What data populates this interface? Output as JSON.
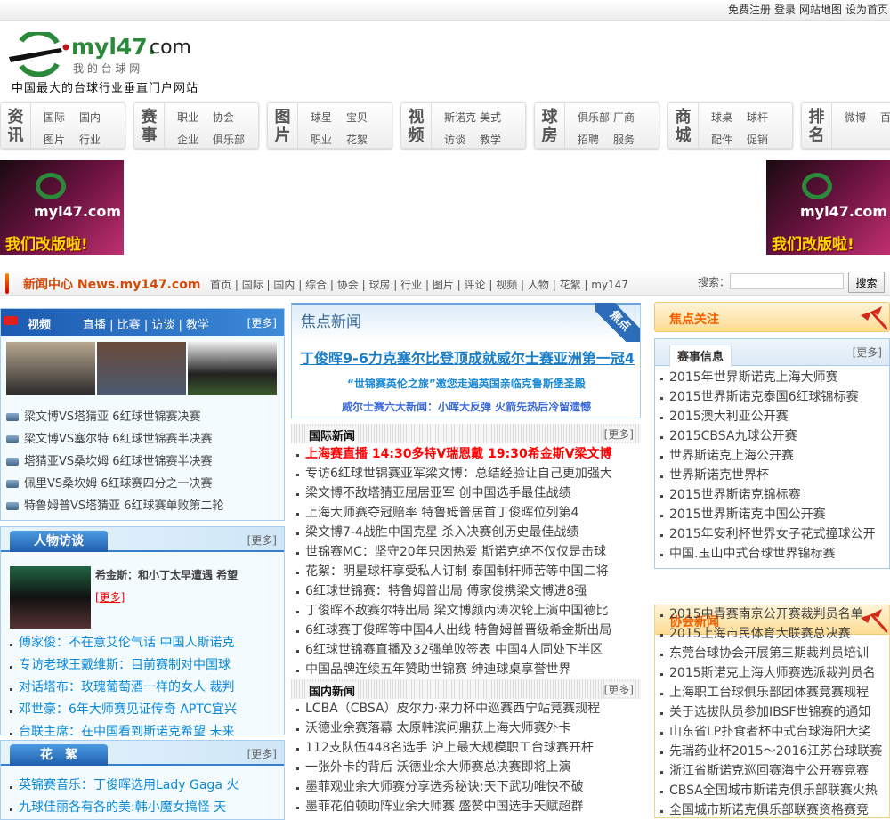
{
  "top_links": [
    "免费注册",
    "登录",
    "网站地图",
    "设为首页"
  ],
  "logo": {
    "text": "myl47. com",
    "sub": "我 的 台 球 网",
    "slogan": "中国最大的台球行业垂直门户网站"
  },
  "nav": [
    {
      "title": [
        "资",
        "讯"
      ],
      "links": [
        "国际",
        "国内",
        "图片",
        "行业"
      ]
    },
    {
      "title": [
        "赛",
        "事"
      ],
      "links": [
        "职业",
        "协会",
        "企业",
        "俱乐部"
      ]
    },
    {
      "title": [
        "图",
        "片"
      ],
      "links": [
        "球星",
        "宝贝",
        "职业",
        "花絮"
      ]
    },
    {
      "title": [
        "视",
        "频"
      ],
      "links": [
        "斯诺克",
        "美式",
        "访谈",
        "教学"
      ]
    },
    {
      "title": [
        "球",
        "房"
      ],
      "links": [
        "俱乐部",
        "厂商",
        "招聘",
        "服务"
      ]
    },
    {
      "title": [
        "商",
        "城"
      ],
      "links": [
        "球桌",
        "球杆",
        "配件",
        "促销"
      ]
    },
    {
      "title": [
        "排",
        "名"
      ],
      "links": [
        "微博",
        "百科"
      ]
    }
  ],
  "ad": {
    "logo": "myl47.com",
    "slogan": "我们改版啦!"
  },
  "newsbar": {
    "brand": "新闻中心 News.my147.com",
    "menu": [
      "首页",
      "国际",
      "国内",
      "综合",
      "协会",
      "球房",
      "行业",
      "图片",
      "评论",
      "视频",
      "人物",
      "花絮",
      "my147"
    ],
    "search_label": "搜索：",
    "search_value": "",
    "search_button": "搜索"
  },
  "video": {
    "title": "视频",
    "tabs": [
      "直播",
      "比赛",
      "访谈",
      "教学"
    ],
    "more": "[更多]",
    "items": [
      "梁文博VS塔猜亚 6红球世锦赛决赛",
      "梁文博VS塞尔特 6红球世锦赛半决赛",
      "塔猜亚VS桑坎姆 6红球世锦赛半决赛",
      "佩里VS桑坎姆 6红球赛四分之一决赛",
      "特鲁姆普VS塔猜亚 6红球赛单败第二轮"
    ]
  },
  "interview": {
    "title": "人物访谈",
    "more": "[更多]",
    "feature_title": "希金斯：和小丁太早遭遇 希望",
    "feature_more": "[更多]",
    "items": [
      "傅家俊：不在意艾伦气话 中国人斯诺克",
      "专访老球王戴维斯：目前赛制对中国球",
      "对话塔布：玫瑰葡萄酒一样的女人 裁判",
      "邓世豪：6年大师赛见证传奇 APTC宜兴",
      "台联主席：在中国看到斯诺克希望 未来"
    ]
  },
  "tidbits": {
    "title": "花　絮",
    "more": "[更多]",
    "items": [
      "英锦赛音乐：丁俊晖选用Lady Gaga 火",
      "九球佳丽各有各的美:韩小魔女搞怪 天"
    ]
  },
  "focus": {
    "title": "焦点新闻",
    "corner": "焦点",
    "headline": "丁俊晖9-6力克塞尔比登顶成就威尔士赛亚洲第一冠4",
    "sub1": "“世锦赛英伦之旅”邀您走遍英国亲临克鲁斯堡圣殿",
    "sub2": "威尔士赛六大新闻：小晖大反弹 火箭先热后冷留遗憾"
  },
  "intl": {
    "title": "国际新闻",
    "more": "[更多]",
    "highlight": "上海赛直播 14:30多特V瑞恩戴 19:30希金斯V梁文博",
    "items": [
      "专访6红球世锦赛亚军梁文博：总结经验让自己更加强大",
      "梁文博不敌塔猜亚屈居亚军 创中国选手最佳战绩",
      "上海大师赛夺冠赔率 特鲁姆普居首丁俊晖位列第4",
      "梁文博7-4战胜中国克星 杀入决赛创历史最佳战绩",
      "世锦赛MC：坚守20年只因热爱 斯诺克绝不仅仅是击球",
      "花絮：明星球杆享受私人订制 泰国制杆师苦等中国二将",
      "6红球世锦赛：特鲁姆普出局 傅家俊携梁文博进8强",
      "丁俊晖不敌赛尔特出局 梁文博颜丙涛次轮上演中国德比",
      "6红球赛丁俊晖等中国4人出线 特鲁姆普晋级希金斯出局",
      "6红球世锦赛直播及32强单败签表 中国4人同处下半区",
      "中国品牌连续五年赞助世锦赛 绅迪球桌享誉世界"
    ]
  },
  "domestic": {
    "title": "国内新闻",
    "more": "[更多]",
    "items": [
      "LCBA（CBSA）皮尔力·来力杯中巡赛西宁站竞赛规程",
      "沃德业余赛落幕 太原韩滨问鼎获上海大师赛外卡",
      "112支队伍448名选手 沪上最大规模职工台球赛开杆",
      "一张外卡的背后 沃德业余大师赛总决赛即将上演",
      "墨菲观业余大师赛分享选秀秘诀:天下武功唯快不破",
      "墨菲花伯顿助阵业余大师赛 盛赞中国选手天赋超群"
    ]
  },
  "focus_follow": {
    "title": "焦点关注"
  },
  "events": {
    "title": "赛事信息",
    "more": "[更多]",
    "items": [
      "2015年世界斯诺克上海大师赛",
      "2015世界斯诺克泰国6红球锦标赛",
      "2015澳大利亚公开赛",
      "2015CBSA九球公开赛",
      "世界斯诺克上海公开赛",
      "世界斯诺克世界杯",
      "2015世界斯诺克锦标赛",
      "2015世界斯诺克中国公开赛",
      "2015年安利杯世界女子花式撞球公开",
      "中国.玉山中式台球世界锦标赛"
    ]
  },
  "assoc": {
    "title": "协会新闻",
    "items": [
      "2015中青赛南京公开赛裁判员名单",
      "2015上海市民体育大联赛总决赛",
      "东莞台球协会开展第三期裁判员培训",
      "2015斯诺克上海大师赛选派裁判员名",
      "上海职工台球俱乐部团体赛竞赛规程",
      "关于选拔队员参加IBSF世锦赛的通知",
      "山东省LP扑食者杯中式台球海阳大奖",
      "先瑞药业杯2015～2016江苏台球联赛",
      "浙江省斯诺克巡回赛海宁公开赛竞赛",
      "CBSA全国城市斯诺克俱乐部联赛火热",
      "全国城市斯诺克俱乐部联赛资格赛竞"
    ]
  }
}
